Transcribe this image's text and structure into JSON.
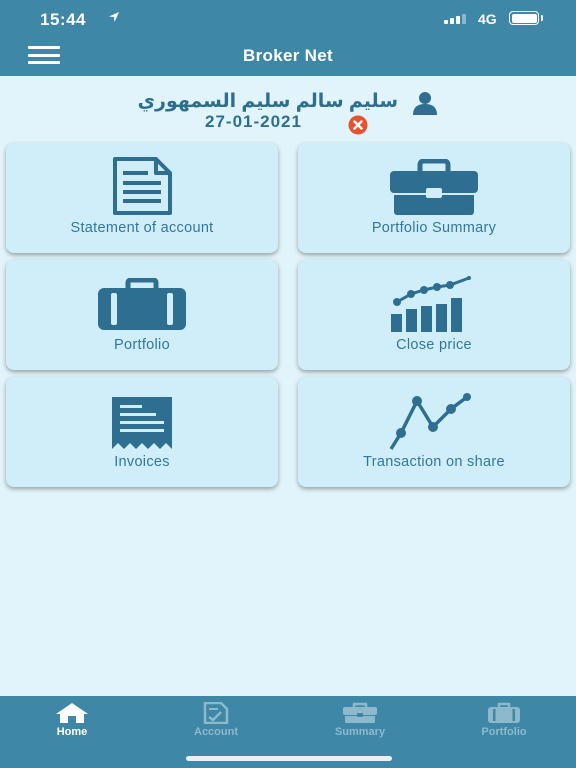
{
  "status_bar": {
    "time": "15:44",
    "network": "4G"
  },
  "header": {
    "title": "Broker Net"
  },
  "user": {
    "name": "سليم سالم سليم السمهوري",
    "date": "27-01-2021"
  },
  "tiles": [
    {
      "label": "Statement of account",
      "icon": "document-icon"
    },
    {
      "label": "Portfolio Summary",
      "icon": "briefcase-icon"
    },
    {
      "label": "Portfolio",
      "icon": "luggage-icon"
    },
    {
      "label": "Close price",
      "icon": "bar-chart-icon"
    },
    {
      "label": "Invoices",
      "icon": "receipt-icon"
    },
    {
      "label": "Transaction on share",
      "icon": "line-chart-icon"
    }
  ],
  "bottom_nav": [
    {
      "label": "Home",
      "icon": "home-icon",
      "active": true
    },
    {
      "label": "Account",
      "icon": "account-icon",
      "active": false
    },
    {
      "label": "Summary",
      "icon": "summary-icon",
      "active": false
    },
    {
      "label": "Portfolio",
      "icon": "portfolio-icon",
      "active": false
    }
  ],
  "colors": {
    "primary": "#3f87a7",
    "background": "#e2f4fb",
    "tile": "#d0eefa",
    "icon": "#2e6f91",
    "logout": "#e5532f"
  }
}
